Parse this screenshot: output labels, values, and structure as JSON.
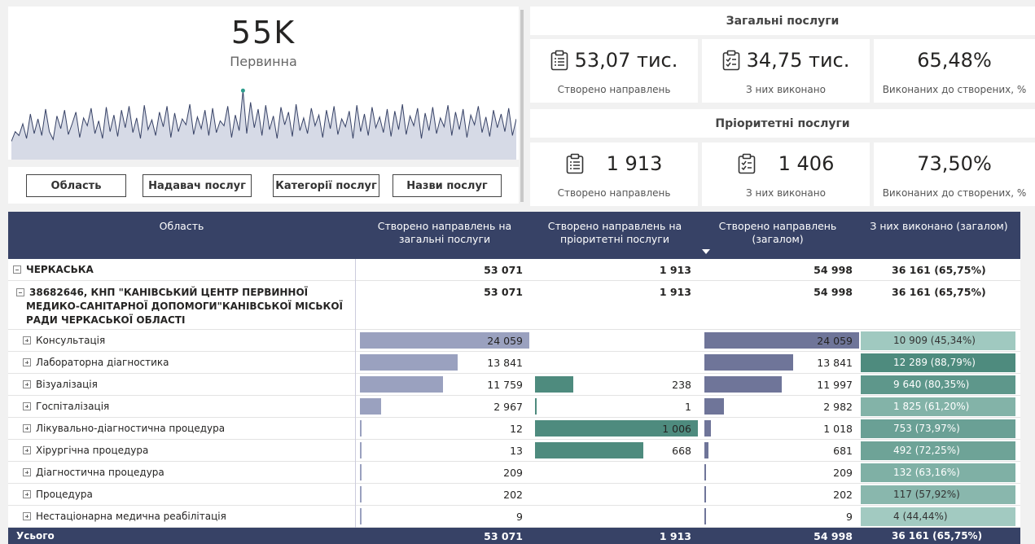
{
  "kpi": {
    "value": "55K",
    "label": "Первинна"
  },
  "sparkline": {
    "values": [
      12,
      22,
      18,
      30,
      15,
      40,
      20,
      35,
      18,
      45,
      22,
      14,
      38,
      25,
      44,
      19,
      30,
      42,
      16,
      36,
      28,
      46,
      20,
      33,
      15,
      47,
      22,
      39,
      17,
      44,
      26,
      48,
      21,
      36,
      15,
      49,
      24,
      34,
      18,
      42,
      27,
      48,
      16,
      41,
      22,
      35,
      29,
      50,
      19,
      37,
      25,
      44,
      18,
      46,
      21,
      33,
      28,
      48,
      16,
      39,
      23,
      64,
      20,
      52,
      26,
      45,
      18,
      49,
      24,
      38,
      15,
      47,
      29,
      42,
      17,
      50,
      23,
      36,
      20,
      46,
      28,
      39,
      16,
      44,
      25,
      48,
      19,
      35,
      27,
      43,
      15,
      49,
      22,
      40,
      18,
      47,
      26,
      37,
      21,
      45,
      17,
      43,
      24,
      50,
      19,
      38,
      28,
      46,
      15,
      41,
      23,
      47,
      20,
      36,
      27,
      49,
      18,
      42,
      24,
      45,
      16,
      39,
      29,
      48,
      21,
      37,
      17,
      44,
      26,
      40,
      22,
      46,
      18,
      35
    ]
  },
  "slicers": [
    "Область",
    "Надавач послуг",
    "Категорії послуг",
    "Назви послуг"
  ],
  "general": {
    "title": "Загальні послуги",
    "created": {
      "value": "53,07 тис.",
      "label": "Створено направлень"
    },
    "done": {
      "value": "34,75 тис.",
      "label": "З них виконано"
    },
    "ratio": {
      "value": "65,48%",
      "label": "Виконаних до створених, %"
    }
  },
  "priority": {
    "title": "Пріоритетні послуги",
    "created": {
      "value": "1 913",
      "label": "Створено направлень"
    },
    "done": {
      "value": "1 406",
      "label": "З них виконано"
    },
    "ratio": {
      "value": "73,50%",
      "label": "Виконаних до створених, %"
    }
  },
  "table": {
    "headers": [
      "Область",
      "Створено направлень на загальні послуги",
      "Створено направлень на пріоритетні послуги",
      "Створено направлень (загалом)",
      "З них виконано (загалом)"
    ],
    "region": {
      "name": "ЧЕРКАСЬКА",
      "general": "53 071",
      "priority": "1 913",
      "total": "54 998",
      "done": "36 161 (65,75%)"
    },
    "provider": {
      "name": "38682646, КНП \"КАНІВСЬКИЙ ЦЕНТР ПЕРВИННОЇ МЕДИКО-САНІТАРНОЇ ДОПОМОГИ\"КАНІВСЬКОЇ МІСЬКОЇ РАДИ ЧЕРКАСЬКОЇ ОБЛАСТІ",
      "general": "53 071",
      "priority": "1 913",
      "total": "54 998",
      "done": "36 161 (65,75%)"
    },
    "rows": [
      {
        "name": "Консультація",
        "general": "24 059",
        "g": 24059,
        "priority": "",
        "p": 0,
        "total": "24 059",
        "t": 24059,
        "done": "10 909 (45,34%)",
        "pct": 45.34
      },
      {
        "name": "Лабораторна діагностика",
        "general": "13 841",
        "g": 13841,
        "priority": "",
        "p": 0,
        "total": "13 841",
        "t": 13841,
        "done": "12 289 (88,79%)",
        "pct": 88.79
      },
      {
        "name": "Візуалізація",
        "general": "11 759",
        "g": 11759,
        "priority": "238",
        "p": 238,
        "total": "11 997",
        "t": 11997,
        "done": "9 640 (80,35%)",
        "pct": 80.35
      },
      {
        "name": "Госпіталізація",
        "general": "2 967",
        "g": 2967,
        "priority": "1",
        "p": 1,
        "total": "2 982",
        "t": 2982,
        "done": "1 825 (61,20%)",
        "pct": 61.2
      },
      {
        "name": "Лікувально-діагностична процедура",
        "general": "12",
        "g": 12,
        "priority": "1 006",
        "p": 1006,
        "total": "1 018",
        "t": 1018,
        "done": "753 (73,97%)",
        "pct": 73.97
      },
      {
        "name": "Хірургічна процедура",
        "general": "13",
        "g": 13,
        "priority": "668",
        "p": 668,
        "total": "681",
        "t": 681,
        "done": "492 (72,25%)",
        "pct": 72.25
      },
      {
        "name": "Діагностична процедура",
        "general": "209",
        "g": 209,
        "priority": "",
        "p": 0,
        "total": "209",
        "t": 209,
        "done": "132 (63,16%)",
        "pct": 63.16
      },
      {
        "name": "Процедура",
        "general": "202",
        "g": 202,
        "priority": "",
        "p": 0,
        "total": "202",
        "t": 202,
        "done": "117 (57,92%)",
        "pct": 57.92
      },
      {
        "name": "Нестаціонарна медична реабілітація",
        "general": "9",
        "g": 9,
        "priority": "",
        "p": 0,
        "total": "9",
        "t": 9,
        "done": "4 (44,44%)",
        "pct": 44.44
      }
    ],
    "total": {
      "name": "Усього",
      "general": "53 071",
      "priority": "1 913",
      "total": "54 998",
      "done": "36 161 (65,75%)"
    }
  },
  "colors": {
    "header": "#374266",
    "bar_general": "#9aa1bf",
    "bar_priority": "#4e8b7e",
    "bar_total": "#6f7599",
    "done_low": "#a3cbc2",
    "done_high": "#4e8b7e"
  }
}
